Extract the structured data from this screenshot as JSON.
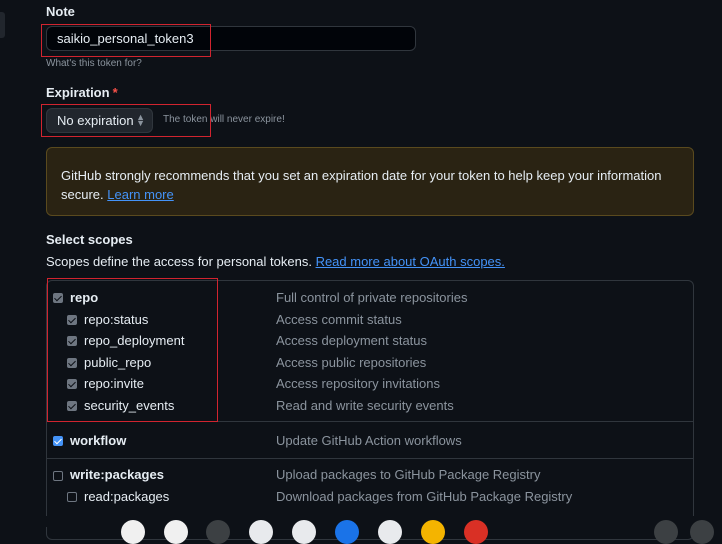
{
  "note": {
    "label": "Note",
    "value": "saikio_personal_token3",
    "hint": "What's this token for?"
  },
  "expiration": {
    "label": "Expiration",
    "required_mark": "*",
    "selected": "No expiration",
    "message": "The token will never expire!"
  },
  "warning": {
    "text": "GitHub strongly recommends that you set an expiration date for your token to help keep your information secure.",
    "link": "Learn more"
  },
  "scopes": {
    "title": "Select scopes",
    "description": "Scopes define the access for personal tokens.",
    "link": "Read more about OAuth scopes.",
    "items": [
      {
        "name": "repo",
        "desc": "Full control of private repositories",
        "checked": true
      },
      {
        "name": "repo:status",
        "desc": "Access commit status",
        "checked": true
      },
      {
        "name": "repo_deployment",
        "desc": "Access deployment status",
        "checked": true
      },
      {
        "name": "public_repo",
        "desc": "Access public repositories",
        "checked": true
      },
      {
        "name": "repo:invite",
        "desc": "Access repository invitations",
        "checked": true
      },
      {
        "name": "security_events",
        "desc": "Read and write security events",
        "checked": true
      },
      {
        "name": "workflow",
        "desc": "Update GitHub Action workflows",
        "checked": true
      },
      {
        "name": "write:packages",
        "desc": "Upload packages to GitHub Package Registry",
        "checked": false
      },
      {
        "name": "read:packages",
        "desc": "Download packages from GitHub Package Registry",
        "checked": false
      }
    ]
  },
  "colors": {
    "background": "#0d1117",
    "link": "#4493f8",
    "highlight_box": "#d1242f",
    "checkbox_checked": "#4493f8"
  }
}
